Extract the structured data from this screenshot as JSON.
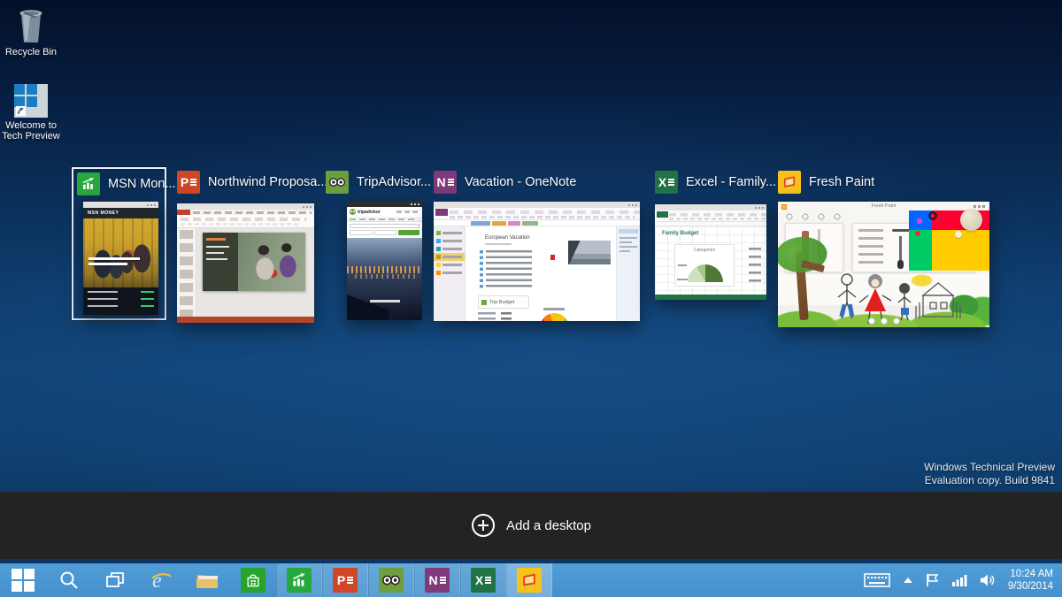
{
  "desktop": {
    "icons": [
      {
        "label": "Recycle Bin"
      },
      {
        "label": "Welcome to Tech Preview"
      }
    ],
    "watermark": {
      "line1": "Windows Technical Preview",
      "line2": "Evaluation copy. Build 9841"
    }
  },
  "task_view": {
    "add_desktop_label": "Add a desktop",
    "windows": [
      {
        "title": "MSN Mon...",
        "app": "msn-money",
        "selected": true,
        "thumb_text": "MSN MONEY"
      },
      {
        "title": "Northwind Proposa...",
        "app": "powerpoint",
        "selected": false
      },
      {
        "title": "TripAdvisor...",
        "app": "tripadvisor",
        "selected": false,
        "thumb_text": "tripadvisor"
      },
      {
        "title": "Vacation - OneNote",
        "app": "onenote",
        "selected": false,
        "thumb_text": "European Vacation",
        "budget_label": "Trip Budget"
      },
      {
        "title": "Excel - Family...",
        "app": "excel",
        "selected": false,
        "thumb_text": "Family Budget",
        "chart_label": "Categories"
      },
      {
        "title": "Fresh Paint",
        "app": "fresh-paint",
        "selected": false,
        "thumb_text": "Fresh Paint"
      }
    ]
  },
  "taskbar": {
    "system_buttons": [
      {
        "name": "start"
      },
      {
        "name": "search"
      },
      {
        "name": "task-view"
      },
      {
        "name": "internet-explorer"
      },
      {
        "name": "file-explorer"
      },
      {
        "name": "store"
      }
    ],
    "running_apps": [
      {
        "name": "msn-money"
      },
      {
        "name": "powerpoint"
      },
      {
        "name": "tripadvisor"
      },
      {
        "name": "onenote"
      },
      {
        "name": "excel"
      },
      {
        "name": "fresh-paint",
        "active": true
      }
    ],
    "tray": {
      "time": "10:24 AM",
      "date": "9/30/2014"
    }
  },
  "colors": {
    "taskbar_blue": "#4a96d2",
    "desktop_top": "#03102a",
    "desktop_mid": "#114578",
    "add_desktop_bar": "#232323",
    "selection_border": "#e9f1f8",
    "excel_green": "#217346",
    "powerpoint_red": "#d04727",
    "onenote_purple": "#80397b",
    "msn_green": "#27a83c",
    "tripadvisor_green": "#6f9e3f",
    "freshpaint_yellow": "#f7c21c",
    "store_green": "#28a32b"
  }
}
